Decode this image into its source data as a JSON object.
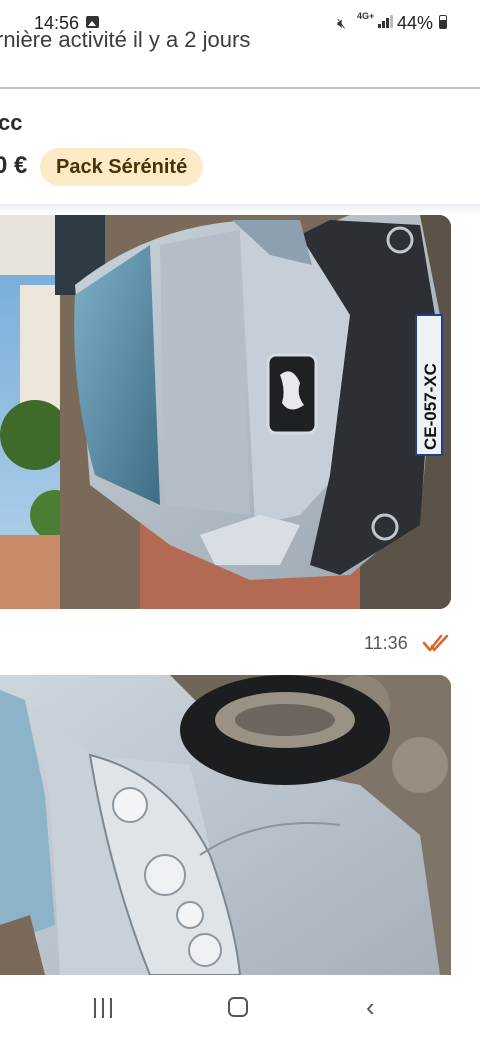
{
  "status_bar": {
    "time": "14:56",
    "network": "4G+",
    "battery": "44%",
    "icons": [
      "gallery-icon",
      "mute-icon",
      "signal-icon",
      "battery-icon"
    ]
  },
  "header": {
    "last_activity": "rnière activité il y a 2 jours"
  },
  "listing": {
    "title": "cc",
    "price": "0 €",
    "badge": "Pack Sérénité"
  },
  "messages": [
    {
      "type": "image",
      "content": "car front view with license plate",
      "plate": "CE-057-XC"
    },
    {
      "type": "meta",
      "time": "11:36",
      "status_icon": "double-check-icon"
    },
    {
      "type": "image",
      "content": "car side view with headlight and wheel"
    }
  ],
  "navigation": {
    "icons": [
      "recent-apps-icon",
      "home-icon",
      "back-icon"
    ]
  },
  "colors": {
    "badge_bg": "#fdebc8",
    "badge_text": "#4b3205",
    "read_check": "#e0622a",
    "divider": "#b9c2cc"
  }
}
